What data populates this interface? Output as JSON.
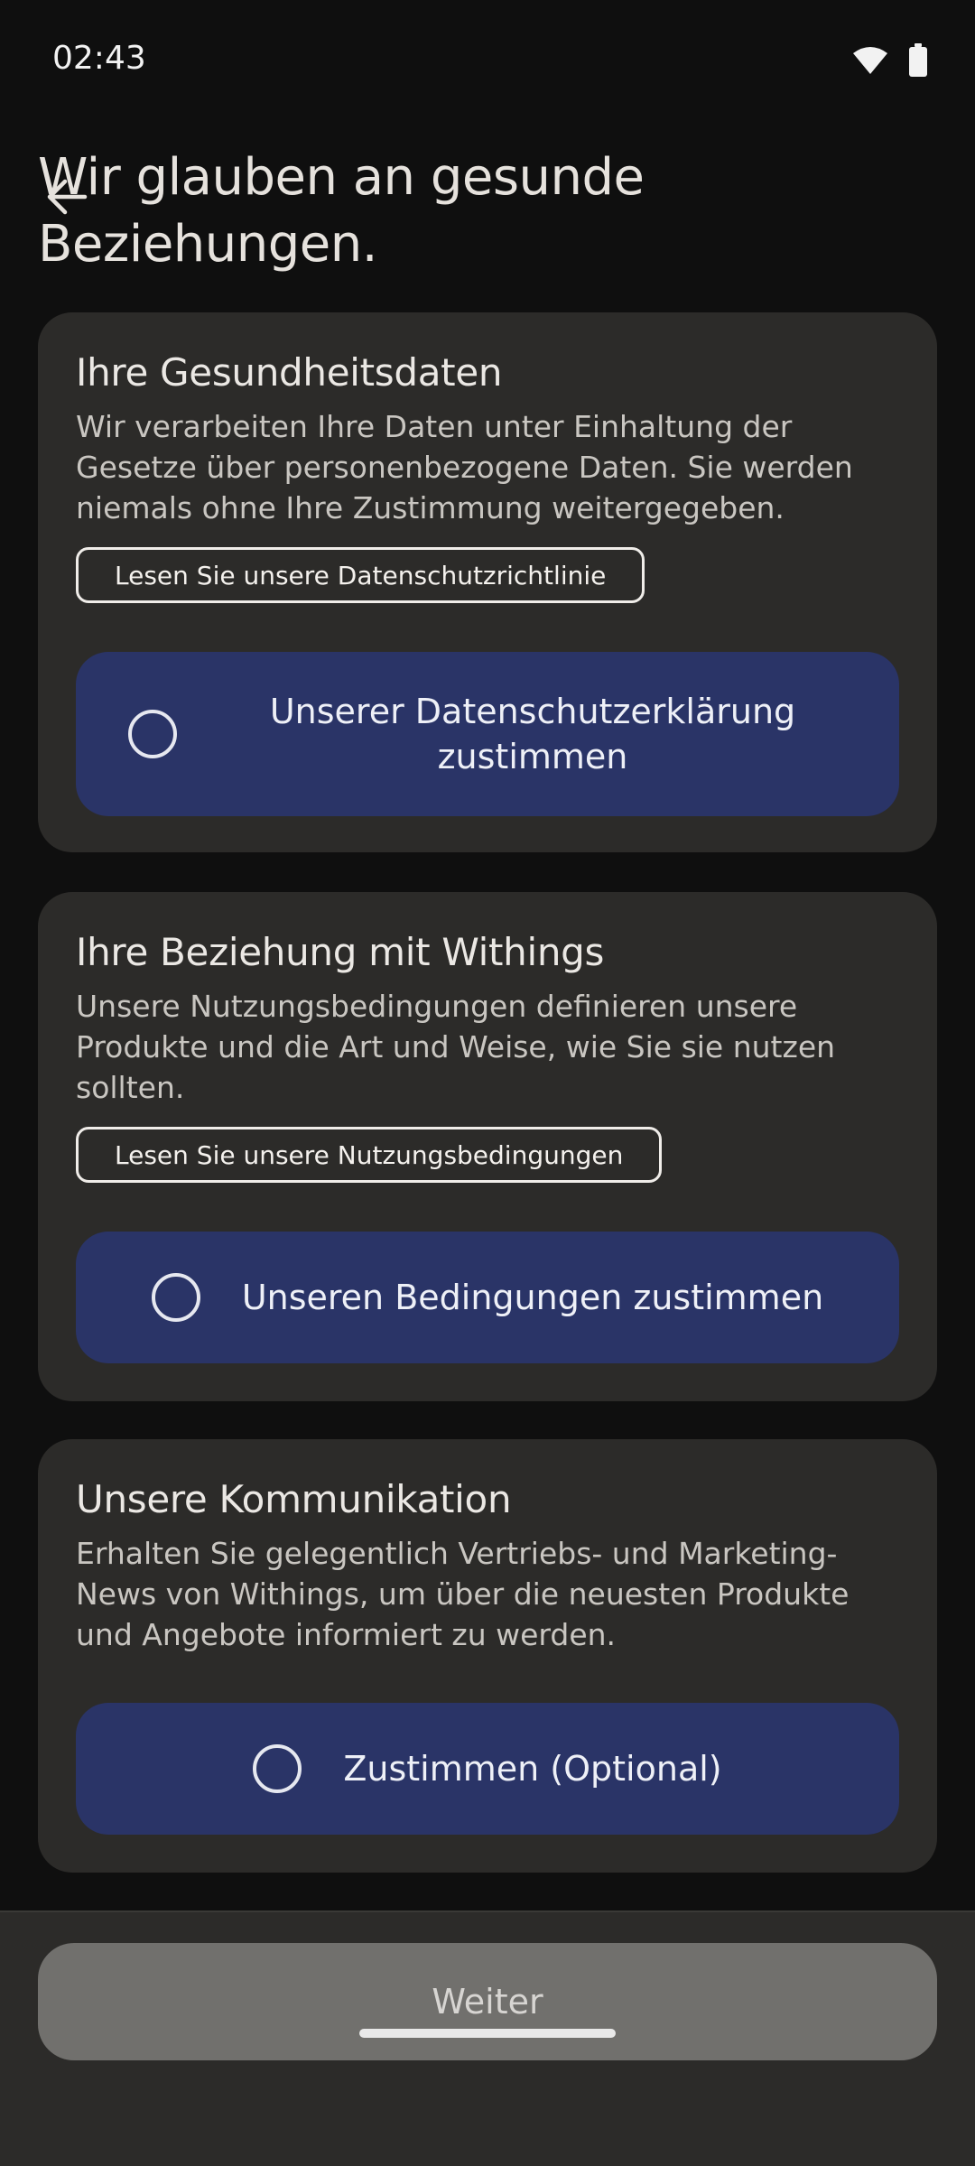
{
  "status_bar": {
    "time": "02:43"
  },
  "header": {
    "title_line1": "Wir glauben an gesunde",
    "title_line2": "Beziehungen."
  },
  "cards": [
    {
      "title": "Ihre Gesundheitsdaten",
      "description": "Wir verarbeiten Ihre Daten unter Einhaltung der Gesetze über personenbezogene Daten. Sie werden niemals ohne Ihre Zustimmung weitergegeben.",
      "link_label": "Lesen Sie unsere Datenschutzrichtlinie",
      "consent_line1": "Unserer Datenschutzerklärung",
      "consent_line2": "zustimmen"
    },
    {
      "title": "Ihre Beziehung mit Withings",
      "description": "Unsere Nutzungsbedingungen definieren unsere Produkte und die Art und Weise, wie Sie sie nutzen sollten.",
      "link_label": "Lesen Sie unsere Nutzungsbedingungen",
      "consent_label": "Unseren Bedingungen zustimmen"
    },
    {
      "title": "Unsere Kommunikation",
      "description": "Erhalten Sie gelegentlich Vertriebs- und Marketing-News von Withings, um über die neuesten Produkte und Angebote informiert zu werden.",
      "consent_label": "Zustimmen (Optional)"
    }
  ],
  "footer": {
    "continue_label": "Weiter"
  },
  "colors": {
    "background": "#0f0f0f",
    "card": "#2c2b29",
    "consent_button": "#2a3467",
    "continue_button_disabled": "#71706d"
  }
}
